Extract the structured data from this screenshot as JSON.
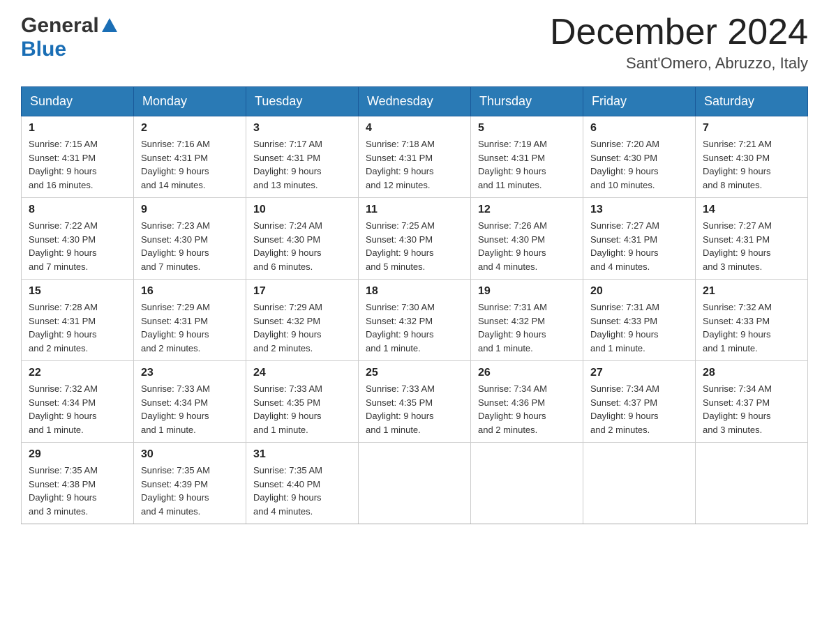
{
  "header": {
    "logo_line1": "General",
    "logo_line2": "Blue",
    "month_title": "December 2024",
    "subtitle": "Sant'Omero, Abruzzo, Italy"
  },
  "days_of_week": [
    "Sunday",
    "Monday",
    "Tuesday",
    "Wednesday",
    "Thursday",
    "Friday",
    "Saturday"
  ],
  "weeks": [
    [
      {
        "day": "1",
        "sunrise": "7:15 AM",
        "sunset": "4:31 PM",
        "daylight": "9 hours and 16 minutes."
      },
      {
        "day": "2",
        "sunrise": "7:16 AM",
        "sunset": "4:31 PM",
        "daylight": "9 hours and 14 minutes."
      },
      {
        "day": "3",
        "sunrise": "7:17 AM",
        "sunset": "4:31 PM",
        "daylight": "9 hours and 13 minutes."
      },
      {
        "day": "4",
        "sunrise": "7:18 AM",
        "sunset": "4:31 PM",
        "daylight": "9 hours and 12 minutes."
      },
      {
        "day": "5",
        "sunrise": "7:19 AM",
        "sunset": "4:31 PM",
        "daylight": "9 hours and 11 minutes."
      },
      {
        "day": "6",
        "sunrise": "7:20 AM",
        "sunset": "4:30 PM",
        "daylight": "9 hours and 10 minutes."
      },
      {
        "day": "7",
        "sunrise": "7:21 AM",
        "sunset": "4:30 PM",
        "daylight": "9 hours and 8 minutes."
      }
    ],
    [
      {
        "day": "8",
        "sunrise": "7:22 AM",
        "sunset": "4:30 PM",
        "daylight": "9 hours and 7 minutes."
      },
      {
        "day": "9",
        "sunrise": "7:23 AM",
        "sunset": "4:30 PM",
        "daylight": "9 hours and 7 minutes."
      },
      {
        "day": "10",
        "sunrise": "7:24 AM",
        "sunset": "4:30 PM",
        "daylight": "9 hours and 6 minutes."
      },
      {
        "day": "11",
        "sunrise": "7:25 AM",
        "sunset": "4:30 PM",
        "daylight": "9 hours and 5 minutes."
      },
      {
        "day": "12",
        "sunrise": "7:26 AM",
        "sunset": "4:30 PM",
        "daylight": "9 hours and 4 minutes."
      },
      {
        "day": "13",
        "sunrise": "7:27 AM",
        "sunset": "4:31 PM",
        "daylight": "9 hours and 4 minutes."
      },
      {
        "day": "14",
        "sunrise": "7:27 AM",
        "sunset": "4:31 PM",
        "daylight": "9 hours and 3 minutes."
      }
    ],
    [
      {
        "day": "15",
        "sunrise": "7:28 AM",
        "sunset": "4:31 PM",
        "daylight": "9 hours and 2 minutes."
      },
      {
        "day": "16",
        "sunrise": "7:29 AM",
        "sunset": "4:31 PM",
        "daylight": "9 hours and 2 minutes."
      },
      {
        "day": "17",
        "sunrise": "7:29 AM",
        "sunset": "4:32 PM",
        "daylight": "9 hours and 2 minutes."
      },
      {
        "day": "18",
        "sunrise": "7:30 AM",
        "sunset": "4:32 PM",
        "daylight": "9 hours and 1 minute."
      },
      {
        "day": "19",
        "sunrise": "7:31 AM",
        "sunset": "4:32 PM",
        "daylight": "9 hours and 1 minute."
      },
      {
        "day": "20",
        "sunrise": "7:31 AM",
        "sunset": "4:33 PM",
        "daylight": "9 hours and 1 minute."
      },
      {
        "day": "21",
        "sunrise": "7:32 AM",
        "sunset": "4:33 PM",
        "daylight": "9 hours and 1 minute."
      }
    ],
    [
      {
        "day": "22",
        "sunrise": "7:32 AM",
        "sunset": "4:34 PM",
        "daylight": "9 hours and 1 minute."
      },
      {
        "day": "23",
        "sunrise": "7:33 AM",
        "sunset": "4:34 PM",
        "daylight": "9 hours and 1 minute."
      },
      {
        "day": "24",
        "sunrise": "7:33 AM",
        "sunset": "4:35 PM",
        "daylight": "9 hours and 1 minute."
      },
      {
        "day": "25",
        "sunrise": "7:33 AM",
        "sunset": "4:35 PM",
        "daylight": "9 hours and 1 minute."
      },
      {
        "day": "26",
        "sunrise": "7:34 AM",
        "sunset": "4:36 PM",
        "daylight": "9 hours and 2 minutes."
      },
      {
        "day": "27",
        "sunrise": "7:34 AM",
        "sunset": "4:37 PM",
        "daylight": "9 hours and 2 minutes."
      },
      {
        "day": "28",
        "sunrise": "7:34 AM",
        "sunset": "4:37 PM",
        "daylight": "9 hours and 3 minutes."
      }
    ],
    [
      {
        "day": "29",
        "sunrise": "7:35 AM",
        "sunset": "4:38 PM",
        "daylight": "9 hours and 3 minutes."
      },
      {
        "day": "30",
        "sunrise": "7:35 AM",
        "sunset": "4:39 PM",
        "daylight": "9 hours and 4 minutes."
      },
      {
        "day": "31",
        "sunrise": "7:35 AM",
        "sunset": "4:40 PM",
        "daylight": "9 hours and 4 minutes."
      },
      null,
      null,
      null,
      null
    ]
  ],
  "labels": {
    "sunrise_label": "Sunrise:",
    "sunset_label": "Sunset:",
    "daylight_label": "Daylight:"
  }
}
